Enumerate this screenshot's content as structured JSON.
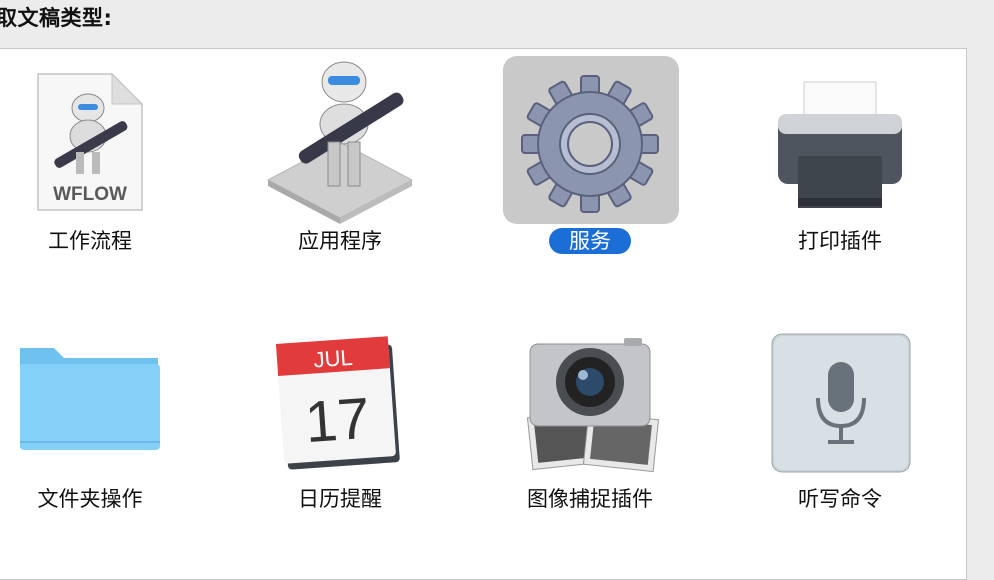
{
  "prompt": "取文稿类型:",
  "items": [
    {
      "id": "workflow",
      "label": "工作流程",
      "sublabel": "WFLOW"
    },
    {
      "id": "application",
      "label": "应用程序"
    },
    {
      "id": "service",
      "label": "服务",
      "selected": true
    },
    {
      "id": "print-plugin",
      "label": "打印插件"
    },
    {
      "id": "folder-action",
      "label": "文件夹操作"
    },
    {
      "id": "calendar-alarm",
      "label": "日历提醒",
      "month": "JUL",
      "day": "17"
    },
    {
      "id": "image-capture-plugin",
      "label": "图像捕捉插件"
    },
    {
      "id": "dictation-command",
      "label": "听写命令"
    }
  ]
}
